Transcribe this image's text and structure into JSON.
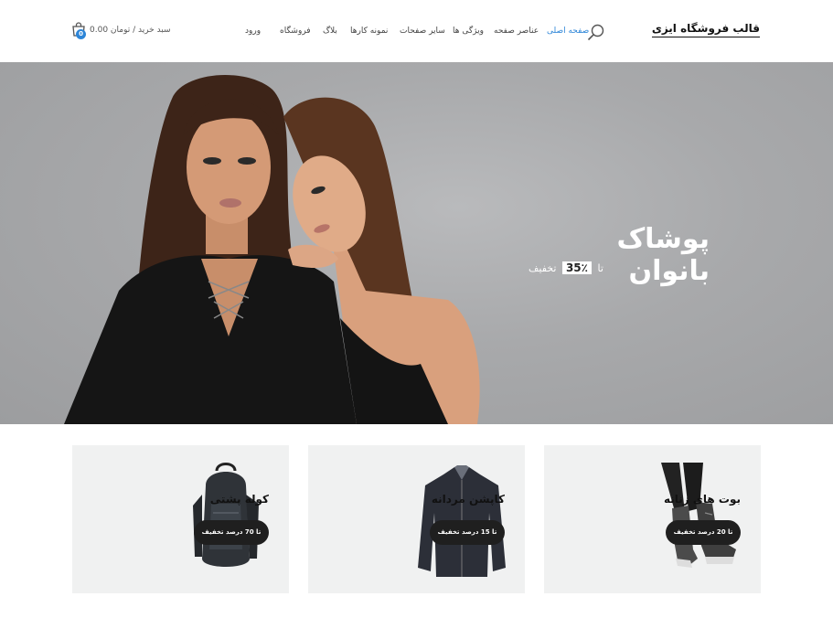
{
  "header": {
    "site_title": "قالب فروشگاه ایزی",
    "nav": {
      "home": "صفحه اصلی",
      "elements": "عناصر صفحه",
      "features": "ویژگی ها",
      "pages": "سایر صفحات",
      "portfolio": "نمونه کارها",
      "blog": "بلاگ",
      "shop": "فروشگاه",
      "login": "ورود"
    },
    "cart_label": "سبد خرید / تومان 0.00",
    "cart_count": "0"
  },
  "hero": {
    "title": "پوشاک بانوان",
    "sub_prefix": "تا",
    "sub_number": "35٪",
    "sub_suffix": "تخفیف",
    "background": "#a9aaac"
  },
  "cards": [
    {
      "title": "بوت های زنانه",
      "button": "تا 20 درصد تخفیف",
      "icon": "boots-icon"
    },
    {
      "title": "کاپشن مردانه",
      "button": "تا 15 درصد تخفیف",
      "icon": "jacket-icon"
    },
    {
      "title": "کوله پشتی",
      "button": "تا 70 درصد تخفیف",
      "icon": "backpack-icon"
    }
  ],
  "colors": {
    "accent": "#2e86d8",
    "card_bg": "#f0f1f1",
    "button_bg": "#1f1f1f"
  }
}
